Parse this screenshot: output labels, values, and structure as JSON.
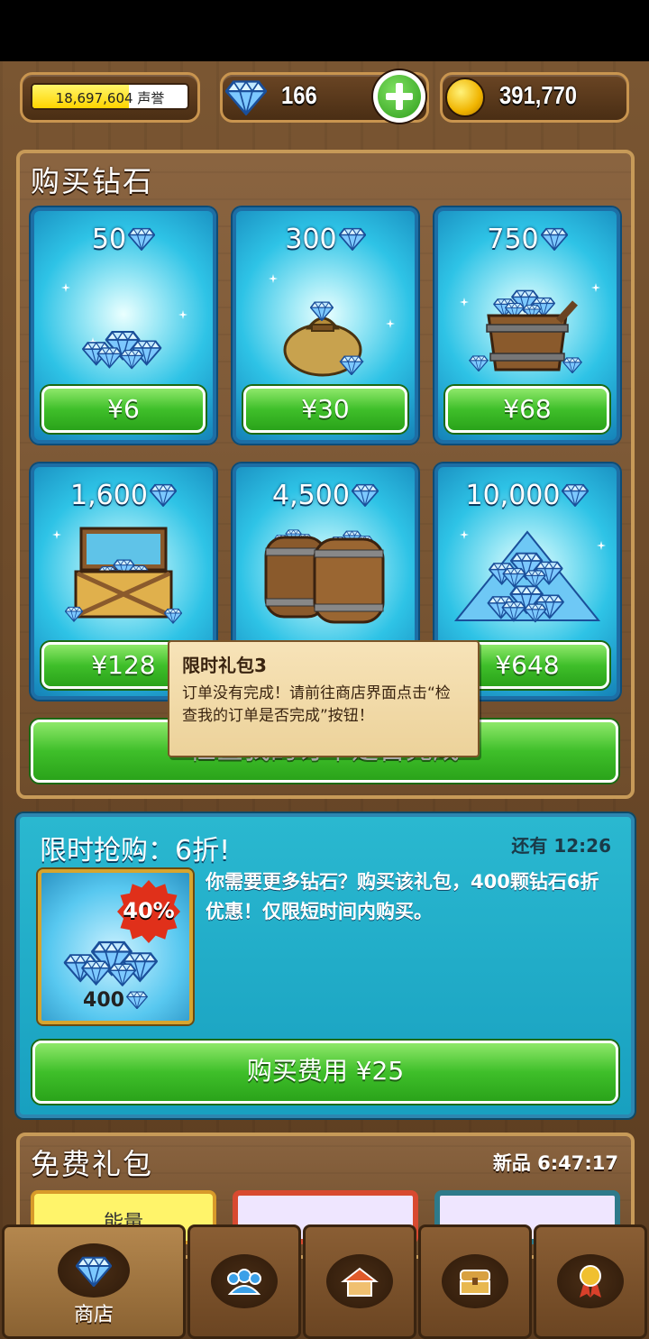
{
  "topbar": {
    "reputation_value": "18,697,604",
    "reputation_unit": "声誉",
    "reputation_fill": 0.62,
    "gems": "166",
    "coins": "391,770"
  },
  "buy_gems": {
    "title": "购买钻石",
    "packs": [
      {
        "amount": "50",
        "price": "¥6",
        "image": "small-gem-pile"
      },
      {
        "amount": "300",
        "price": "¥30",
        "image": "gem-sack"
      },
      {
        "amount": "750",
        "price": "¥68",
        "image": "gem-bucket"
      },
      {
        "amount": "1,600",
        "price": "¥128",
        "image": "gem-chest"
      },
      {
        "amount": "4,500",
        "price": "",
        "image": "gem-barrels"
      },
      {
        "amount": "10,000",
        "price": "¥648",
        "image": "gem-mountain"
      }
    ],
    "check_order_label": "检查我的订单是否完成"
  },
  "tooltip": {
    "title": "限时礼包3",
    "body": "订单没有完成！请前往商店界面点击“检查我的订单是否完成”按钮！"
  },
  "flash_sale": {
    "title": "限时抢购：6折!",
    "timer": "还有 12:26",
    "discount_badge": "40%",
    "pack_amount": "400",
    "description": "你需要更多钻石？购买该礼包，400颗钻石6折优惠！仅限短时间内购买。",
    "buy_label": "购买费用 ¥25"
  },
  "free_gifts": {
    "title": "免费礼包",
    "timer": "新品 6:47:17",
    "first_item_label": "能量"
  },
  "bottom_nav": {
    "tabs": [
      {
        "label": "商店",
        "icon": "gem-icon",
        "active": true
      },
      {
        "label": "",
        "icon": "people-icon",
        "active": false
      },
      {
        "label": "",
        "icon": "house-icon",
        "active": false
      },
      {
        "label": "",
        "icon": "chest-icon",
        "active": false
      },
      {
        "label": "",
        "icon": "medal-icon",
        "active": false
      }
    ]
  },
  "colors": {
    "panel_border": "#c79a58",
    "green_button": "#3fbf2a",
    "card_blue": "#2ec3e6",
    "sale_bg": "#18a0c0"
  }
}
